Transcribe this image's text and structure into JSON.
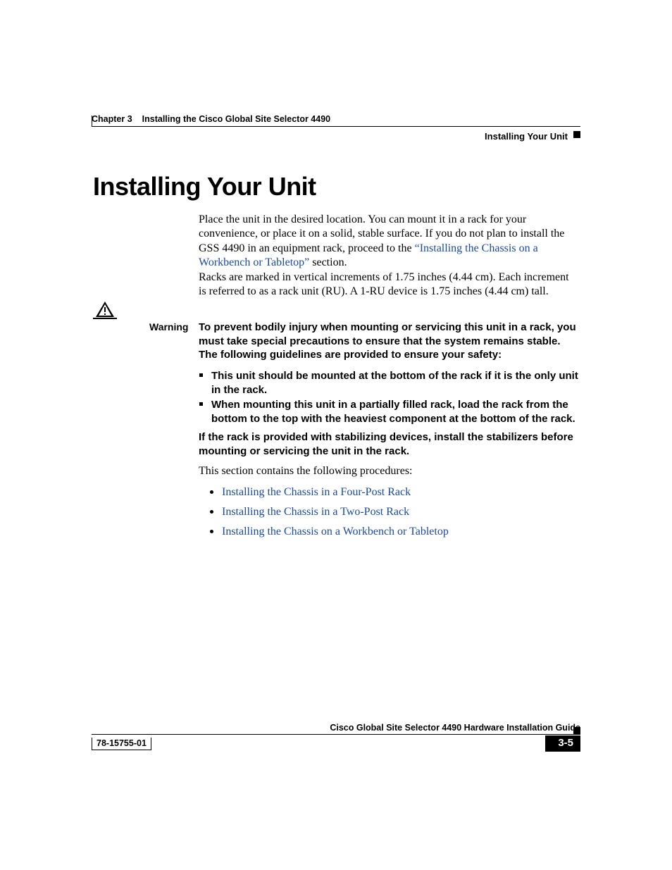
{
  "header": {
    "chapter": "Chapter 3",
    "chapter_title": "Installing the Cisco Global Site Selector 4490",
    "section": "Installing Your Unit"
  },
  "heading": "Installing Your Unit",
  "para1a": "Place the unit in the desired location. You can mount it in a rack for your convenience, or place it on a solid, stable surface. If you do not plan to install the GSS 4490 in an equipment rack, proceed to the ",
  "link1": "“Installing the Chassis on a Workbench or Tabletop”",
  "para1b": " section.",
  "para2": "Racks are marked in vertical increments of 1.75 inches (4.44 cm). Each increment is referred to as a rack unit (RU). A 1-RU device is 1.75 inches (4.44 cm) tall.",
  "warning": {
    "label": "Warning",
    "body": "To prevent bodily injury when mounting or servicing this unit in a rack, you must take special precautions to ensure that the system remains stable. The following guidelines are provided to ensure your safety:",
    "items": [
      "This unit should be mounted at the bottom of the rack if it is the only unit in the rack.",
      "When mounting this unit in a partially filled rack, load the rack from the bottom to the top with the heaviest component at the bottom of the rack."
    ],
    "tail": "If the rack is provided with stabilizing devices, install the stabilizers before mounting or servicing the unit in the rack."
  },
  "procedures": {
    "intro": "This section contains the following procedures:",
    "items": [
      "Installing the Chassis in a Four-Post Rack",
      "Installing the Chassis in a Two-Post Rack",
      "Installing the Chassis on a Workbench or Tabletop"
    ]
  },
  "footer": {
    "guide": "Cisco Global Site Selector 4490 Hardware Installation Guide",
    "docnum": "78-15755-01",
    "page": "3-5"
  }
}
